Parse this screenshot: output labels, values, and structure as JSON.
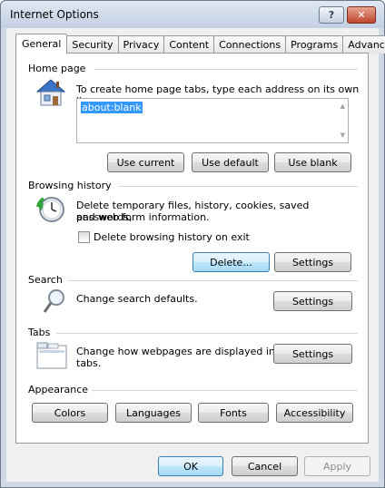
{
  "window": {
    "title": "Internet Options",
    "help_label": "?",
    "close_label": "✕"
  },
  "tabs": [
    "General",
    "Security",
    "Privacy",
    "Content",
    "Connections",
    "Programs",
    "Advanced"
  ],
  "home_page": {
    "title": "Home page",
    "description": "To create home page tabs, type each address on its own line.",
    "value": "about:blank",
    "use_current": "Use current",
    "use_default": "Use default",
    "use_blank": "Use blank"
  },
  "browsing_history": {
    "title": "Browsing history",
    "description_line1": "Delete temporary files, history, cookies, saved passwords,",
    "description_line2": "and web form information.",
    "checkbox_label": "Delete browsing history on exit",
    "checkbox_checked": false,
    "delete_label": "Delete...",
    "settings_label": "Settings"
  },
  "search": {
    "title": "Search",
    "description": "Change search defaults.",
    "settings_label": "Settings"
  },
  "tabs_group": {
    "title": "Tabs",
    "description_line1": "Change how webpages are displayed in",
    "description_line2": "tabs.",
    "settings_label": "Settings"
  },
  "appearance": {
    "title": "Appearance",
    "colors": "Colors",
    "languages": "Languages",
    "fonts": "Fonts",
    "accessibility": "Accessibility"
  },
  "footer": {
    "ok": "OK",
    "cancel": "Cancel",
    "apply": "Apply"
  }
}
